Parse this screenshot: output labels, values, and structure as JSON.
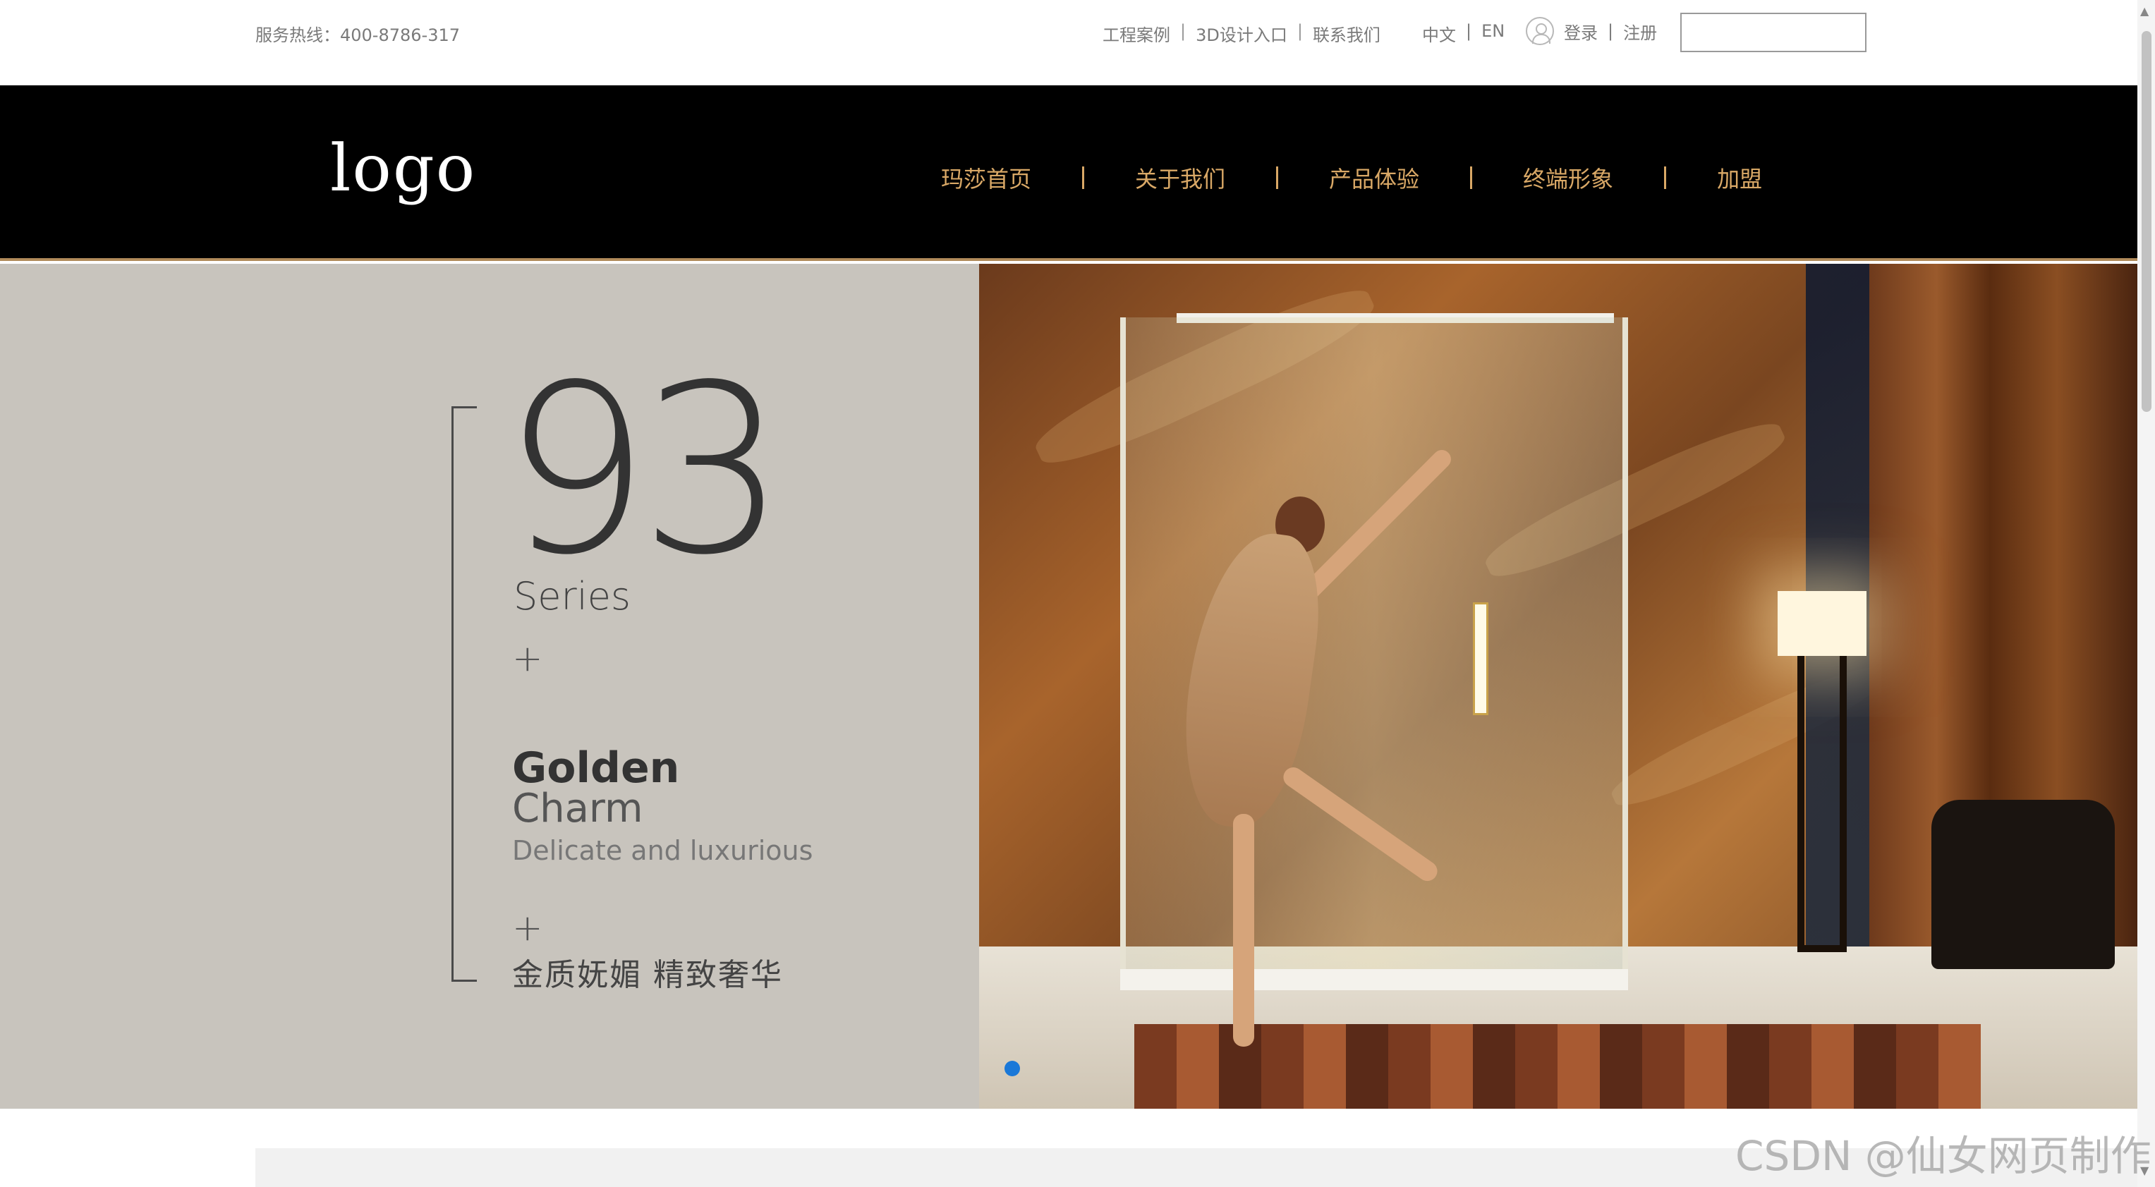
{
  "topbar": {
    "hotline": "服务热线：400-8786-317",
    "links": [
      "工程案例",
      "3D设计入口",
      "联系我们"
    ],
    "lang": [
      "中文",
      "EN"
    ],
    "login": "登录",
    "register": "注册",
    "search_value": ""
  },
  "navbar": {
    "logo": "logo",
    "items": [
      "玛莎首页",
      "关于我们",
      "产品体验",
      "终端形象",
      "加盟"
    ]
  },
  "banner": {
    "number": "93",
    "series": "Series",
    "plus": "+",
    "golden": "Golden",
    "charm": "Charm",
    "delicate": "Delicate and luxurious",
    "slogan": "金质妩媚  精致奢华"
  },
  "watermark": "CSDN @仙女网页制作",
  "colors": {
    "nav_text": "#d9a866",
    "banner_left_bg": "#c8c4bd",
    "carousel_dot": "#1a78d8"
  }
}
